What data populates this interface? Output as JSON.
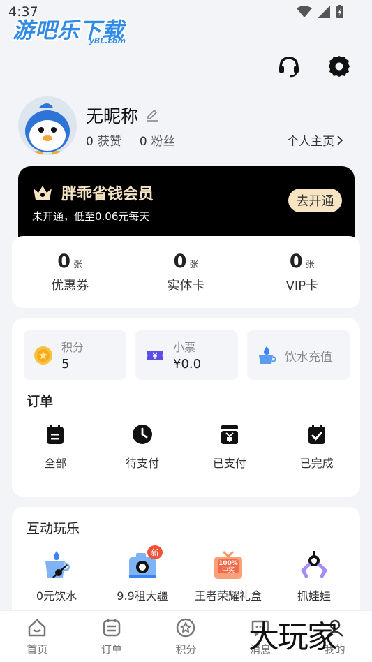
{
  "status_bar": {
    "time": "4:37"
  },
  "watermark_top": {
    "main": "游吧乐下载",
    "sub": "yBL.com"
  },
  "watermark_bottom": {
    "text": "大玩家"
  },
  "profile": {
    "nickname": "无昵称",
    "likes_count": "0",
    "likes_label": "获赞",
    "fans_count": "0",
    "fans_label": "粉丝",
    "homepage_label": "个人主页"
  },
  "vip": {
    "title": "胖乖省钱会员",
    "subtitle": "未开通，低至0.06元每天",
    "button_label": "去开通"
  },
  "tickets": [
    {
      "count": "0",
      "unit": "张",
      "label": "优惠券"
    },
    {
      "count": "0",
      "unit": "张",
      "label": "实体卡"
    },
    {
      "count": "0",
      "unit": "张",
      "label": "VIP卡"
    }
  ],
  "wallet": {
    "points_label": "积分",
    "points_value": "5",
    "ticket_label": "小票",
    "ticket_value": "¥0.0",
    "water_label": "饮水充值"
  },
  "orders": {
    "title": "订单",
    "items": [
      "全部",
      "待支付",
      "已支付",
      "已完成"
    ]
  },
  "fun": {
    "title": "互动玩乐",
    "new_badge": "新",
    "items": [
      "0元饮水",
      "9.9租大疆",
      "王者荣耀礼盒",
      "抓娃娃"
    ]
  },
  "tabs": [
    "首页",
    "订单",
    "积分",
    "消息",
    "我的"
  ],
  "colors": {
    "accent_blue": "#2f8be6",
    "vip_gold": "#f7e4c3",
    "badge_red": "#f0533b"
  }
}
